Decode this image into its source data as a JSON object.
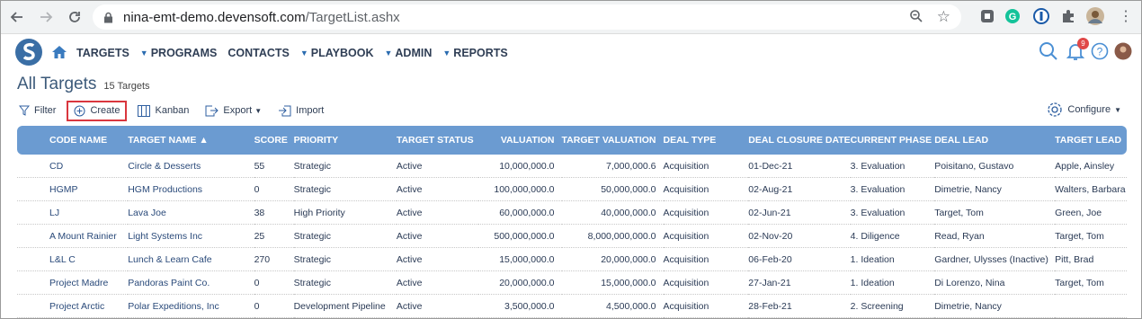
{
  "browser": {
    "url_host": "nina-emt-demo.devensoft.com",
    "url_path": "/TargetList.ashx"
  },
  "nav": {
    "items": [
      {
        "label": "TARGETS",
        "caret": false
      },
      {
        "label": "PROGRAMS",
        "caret": true
      },
      {
        "label": "CONTACTS",
        "caret": false
      },
      {
        "label": "PLAYBOOK",
        "caret": true
      },
      {
        "label": "ADMIN",
        "caret": true
      },
      {
        "label": "REPORTS",
        "caret": true
      }
    ],
    "notification_count": "9"
  },
  "page": {
    "title": "All Targets",
    "count": "15 Targets"
  },
  "toolbar": {
    "filter": "Filter",
    "create": "Create",
    "kanban": "Kanban",
    "export": "Export",
    "import": "Import",
    "configure": "Configure"
  },
  "table": {
    "columns": [
      "CODE NAME",
      "TARGET NAME ▲",
      "SCORE",
      "PRIORITY",
      "TARGET STATUS",
      "VALUATION",
      "TARGET VALUATION",
      "DEAL TYPE",
      "DEAL CLOSURE DATE",
      "CURRENT PHASE",
      "DEAL LEAD",
      "TARGET LEAD"
    ],
    "rows": [
      [
        "CD",
        "Circle & Desserts",
        "55",
        "Strategic",
        "Active",
        "10,000,000.0",
        "7,000,000.6",
        "Acquisition",
        "01-Dec-21",
        "3. Evaluation",
        "Poisitano, Gustavo",
        "Apple, Ainsley"
      ],
      [
        "HGMP",
        "HGM Productions",
        "0",
        "Strategic",
        "Active",
        "100,000,000.0",
        "50,000,000.0",
        "Acquisition",
        "02-Aug-21",
        "3. Evaluation",
        "Dimetrie, Nancy",
        "Walters, Barbara"
      ],
      [
        "LJ",
        "Lava Joe",
        "38",
        "High Priority",
        "Active",
        "60,000,000.0",
        "40,000,000.0",
        "Acquisition",
        "02-Jun-21",
        "3. Evaluation",
        "Target, Tom",
        "Green, Joe"
      ],
      [
        "A Mount Rainier",
        "Light Systems Inc",
        "25",
        "Strategic",
        "Active",
        "500,000,000.0",
        "8,000,000,000.0",
        "Acquisition",
        "02-Nov-20",
        "4. Diligence",
        "Read, Ryan",
        "Target, Tom"
      ],
      [
        "L&L C",
        "Lunch & Learn Cafe",
        "270",
        "Strategic",
        "Active",
        "15,000,000.0",
        "20,000,000.0",
        "Acquisition",
        "06-Feb-20",
        "1. Ideation",
        "Gardner, Ulysses (Inactive)",
        "Pitt, Brad"
      ],
      [
        "Project Madre",
        "Pandoras Paint Co.",
        "0",
        "Strategic",
        "Active",
        "20,000,000.0",
        "15,000,000.0",
        "Acquisition",
        "27-Jan-21",
        "1. Ideation",
        "Di Lorenzo, Nina",
        "Target, Tom"
      ],
      [
        "Project Arctic",
        "Polar Expeditions, Inc",
        "0",
        "Development Pipeline",
        "Active",
        "3,500,000.0",
        "4,500,000.0",
        "Acquisition",
        "28-Feb-21",
        "2. Screening",
        "Dimetrie, Nancy",
        ""
      ]
    ]
  },
  "colors": {
    "header_bg": "#6b9bd1",
    "title": "#3c5a7a",
    "highlight": "#d9363e"
  }
}
